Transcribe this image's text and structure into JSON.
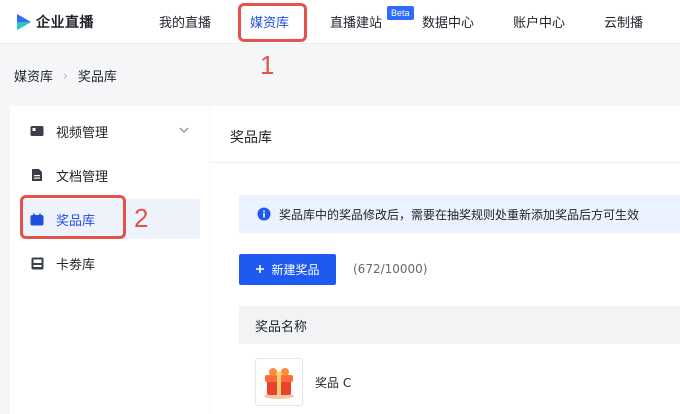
{
  "brand": {
    "name": "企业直播"
  },
  "nav": {
    "items": [
      "我的直播",
      "媒资库",
      "直播建站",
      "数据中心",
      "账户中心",
      "云制播"
    ],
    "active": "媒资库",
    "beta": "Beta"
  },
  "annotations": {
    "one": "1",
    "two": "2"
  },
  "breadcrumb": {
    "parent": "媒资库",
    "current": "奖品库"
  },
  "sidebar": {
    "items": [
      {
        "label": "视频管理",
        "icon": "video-icon"
      },
      {
        "label": "文档管理",
        "icon": "document-icon"
      },
      {
        "label": "奖品库",
        "icon": "gift-icon"
      },
      {
        "label": "卡劵库",
        "icon": "card-icon"
      }
    ],
    "active": "奖品库"
  },
  "main": {
    "title": "奖品库",
    "notice": "奖品库中的奖品修改后，需要在抽奖规则处重新添加奖品后方可生效",
    "new_button": "新建奖品",
    "new_button_icon": "plus-icon",
    "count": "(672/10000)",
    "column_header": "奖品名称",
    "rows": [
      {
        "name": "奖品 C",
        "thumb_icon": "gift-box-icon"
      }
    ]
  },
  "colors": {
    "accent": "#1f4fe0",
    "annotation": "#e5524b",
    "button": "#1f5af0"
  }
}
